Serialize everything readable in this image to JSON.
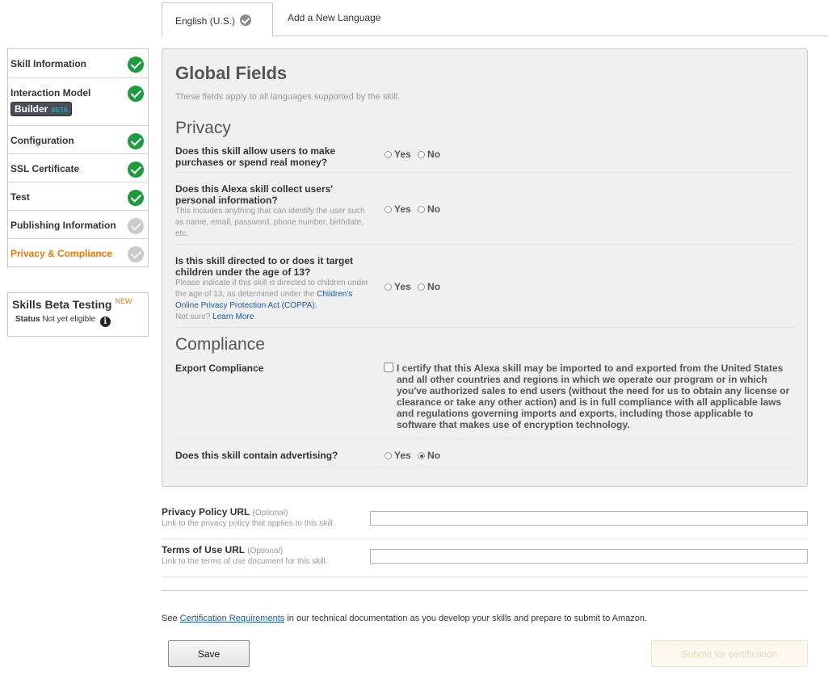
{
  "tabs": {
    "active_label": "English (U.S.)",
    "add_label": "Add a New Language"
  },
  "sidebar": {
    "items": [
      {
        "label": "Skill Information",
        "status": "complete"
      },
      {
        "label": "Interaction Model",
        "status": "complete",
        "badge": "Builder",
        "badge_sup": "BETA"
      },
      {
        "label": "Configuration",
        "status": "complete"
      },
      {
        "label": "SSL Certificate",
        "status": "complete"
      },
      {
        "label": "Test",
        "status": "complete"
      },
      {
        "label": "Publishing Information",
        "status": "incomplete"
      },
      {
        "label": "Privacy & Compliance",
        "status": "incomplete",
        "current": true
      }
    ]
  },
  "beta_testing": {
    "title": "Skills Beta Testing",
    "new_badge": "NEW",
    "status_label": "Status",
    "status_value": "Not yet eligible",
    "info_icon": "info-icon"
  },
  "panel": {
    "title": "Global Fields",
    "subtitle": "These fields apply to all languages supported by the skill.",
    "privacy_heading": "Privacy",
    "compliance_heading": "Compliance",
    "yes_label": "Yes",
    "no_label": "No",
    "questions": [
      {
        "text": "Does this skill allow users to make purchases or spend real money?",
        "selected": null
      },
      {
        "text": "Does this Alexa skill collect users' personal information?",
        "hint": "This includes anything that can identify the user such as name, email, password, phone number, birthdate, etc.",
        "selected": null
      },
      {
        "text": "Is this skill directed to or does it target children under the age of 13?",
        "hint": "Please indicate if this skill is directed to children under the age of 13, as determined under the",
        "hint_link": "Children's Online Privacy Protection Act (COPPA).",
        "hint_tail": "Not sure?",
        "hint_link2": "Learn More",
        "selected": null
      }
    ],
    "export_label": "Export Compliance",
    "export_text": "I certify that this Alexa skill may be imported to and exported from the United States and all other countries and regions in which we operate our program or in which you've authorized sales to end users (without the need for us to obtain any license or clearance or take any other action) and is in full compliance with all applicable laws and regulations governing imports and exports, including those applicable to software that makes use of encryption technology.",
    "export_checked": false,
    "advertising_question": "Does this skill contain advertising?",
    "advertising_selected": "No"
  },
  "urls": {
    "privacy_label": "Privacy Policy URL",
    "privacy_optional": "(Optional)",
    "privacy_desc": "Link to the privacy policy that applies to this skill.",
    "privacy_value": "",
    "terms_label": "Terms of Use URL",
    "terms_optional": "(Optional)",
    "terms_desc": "Link to the terms of use document for this skill.",
    "terms_value": ""
  },
  "footer": {
    "see": "See",
    "link": "Certification Requirements",
    "rest": "in our technical documentation as you develop your skills and prepare to submit to Amazon."
  },
  "buttons": {
    "save": "Save",
    "submit": "Submit for certification"
  },
  "colors": {
    "complete": "#1f9b3f",
    "incomplete": "#cacaca",
    "current": "#e47911",
    "link": "#1a5a9a"
  }
}
